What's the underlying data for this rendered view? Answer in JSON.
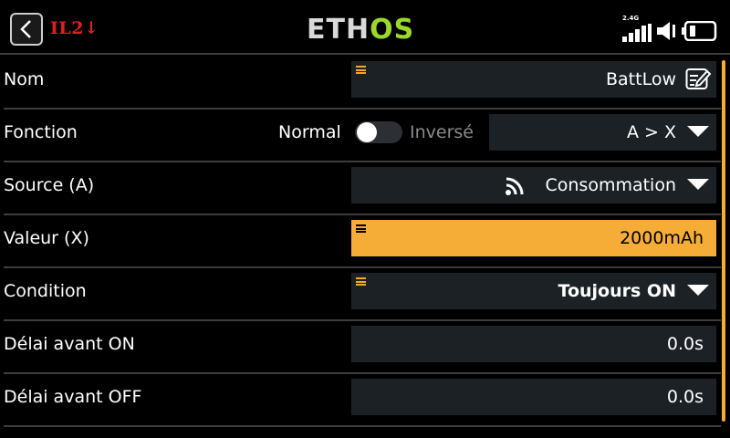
{
  "header": {
    "model_tag": "IL2↓",
    "logo_part1": "ETH",
    "logo_part2": "OS",
    "radio_band": "2.4G",
    "accent_color": "#f6ad37"
  },
  "rows": {
    "nom": {
      "label": "Nom",
      "value": "BattLow",
      "icon": "edit-icon"
    },
    "fonction": {
      "label": "Fonction",
      "toggle_left": "Normal",
      "toggle_right": "Inversé",
      "value": "A > X"
    },
    "source": {
      "label": "Source (A)",
      "value": "Consommation",
      "icon": "telemetry-icon"
    },
    "valeur": {
      "label": "Valeur (X)",
      "value": "2000mAh"
    },
    "condition": {
      "label": "Condition",
      "value": "Toujours ON"
    },
    "delai_on": {
      "label": "Délai avant ON",
      "value": "0.0s"
    },
    "delai_off": {
      "label": "Délai avant OFF",
      "value": "0.0s"
    }
  }
}
